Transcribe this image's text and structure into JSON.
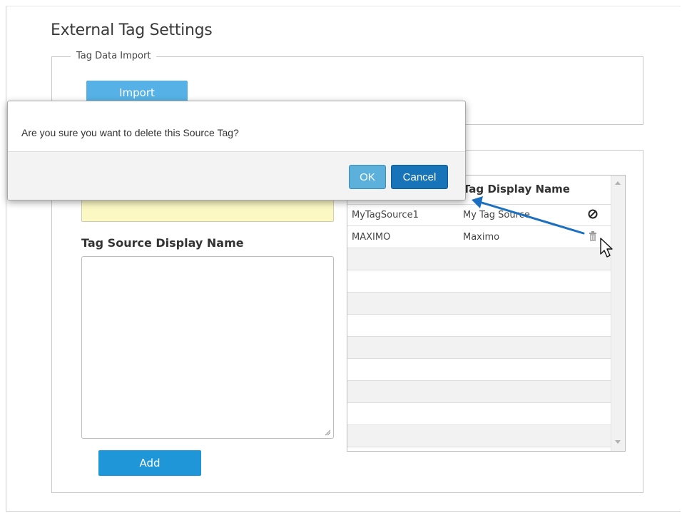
{
  "page": {
    "title": "External Tag Settings"
  },
  "import_section": {
    "legend": "Tag Data Import",
    "import_label": "Import"
  },
  "source_form": {
    "display_name_label": "Tag Source Display Name",
    "add_label": "Add"
  },
  "grid": {
    "column_headers": [
      "",
      "Tag Display Name"
    ],
    "rows": [
      {
        "source": "MyTagSource1",
        "display": "My Tag Source",
        "icon": "disabled-icon"
      },
      {
        "source": "MAXIMO",
        "display": "Maximo",
        "icon": "trash-icon"
      }
    ]
  },
  "dialog": {
    "message": "Are you sure you want to delete this Source Tag?",
    "ok_label": "OK",
    "cancel_label": "Cancel"
  },
  "colors": {
    "primary_button": "#1e96d8",
    "input_highlight": "#fbf8c3",
    "annotation_arrow": "#1a6fc0"
  }
}
